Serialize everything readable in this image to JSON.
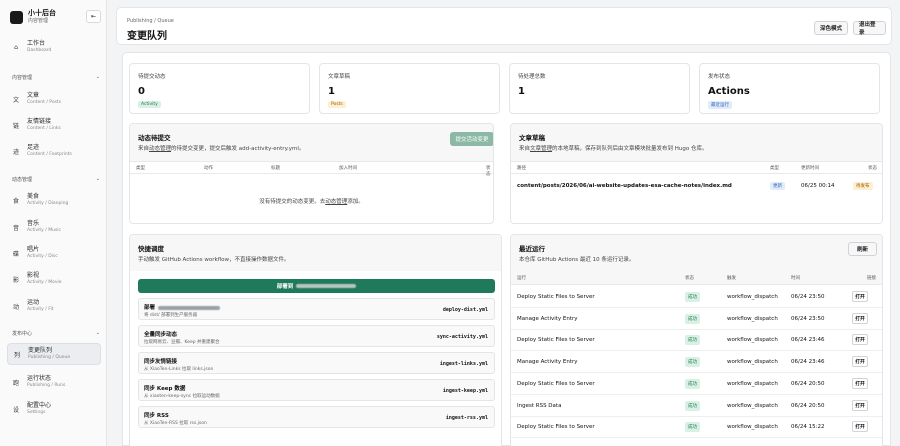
{
  "brand": {
    "name": "小十后台",
    "subtitle": "内容管理"
  },
  "sidebar": {
    "dashboard": {
      "icon": "⌂",
      "label": "工作台",
      "sub": "Dashboard"
    },
    "sections": [
      {
        "label": "内容管理",
        "items": [
          {
            "icon": "文",
            "label": "文章",
            "sub": "Content / Posts"
          },
          {
            "icon": "链",
            "label": "友情链接",
            "sub": "Content / Links"
          },
          {
            "icon": "迹",
            "label": "足迹",
            "sub": "Content / Footprints"
          }
        ]
      },
      {
        "label": "动态管理",
        "items": [
          {
            "icon": "食",
            "label": "美食",
            "sub": "Activity / Dianping"
          },
          {
            "icon": "音",
            "label": "音乐",
            "sub": "Activity / Music"
          },
          {
            "icon": "碟",
            "label": "唱片",
            "sub": "Activity / Disc"
          },
          {
            "icon": "影",
            "label": "影视",
            "sub": "Activity / Movie"
          },
          {
            "icon": "动",
            "label": "运动",
            "sub": "Activity / Fit"
          }
        ]
      },
      {
        "label": "发布中心",
        "items": [
          {
            "icon": "列",
            "label": "变更队列",
            "sub": "Publishing / Queue"
          },
          {
            "icon": "跑",
            "label": "运行状态",
            "sub": "Publishing / Runs"
          },
          {
            "icon": "设",
            "label": "配置中心",
            "sub": "Settings"
          }
        ]
      }
    ]
  },
  "header": {
    "breadcrumb": "Publishing / Queue",
    "title": "变更队列",
    "dark_mode": "深色模式",
    "logout": "退出登录"
  },
  "stats": [
    {
      "title": "待提交动态",
      "value": "0",
      "badge": "Activity"
    },
    {
      "title": "文章草稿",
      "value": "1",
      "badge": "Posts"
    },
    {
      "title": "待处理总数",
      "value": "1",
      "badge": ""
    },
    {
      "title": "发布状态",
      "value": "Actions",
      "badge": "最近运行"
    }
  ],
  "activity_panel": {
    "title": "动态待提交",
    "desc_pre": "来自",
    "desc_link": "动态管理",
    "desc_post": "的待提交变更，提交后触发 add-activity-entry.yml。",
    "submit_button": "提交活动变更",
    "columns": [
      "类型",
      "动作",
      "标题",
      "加入时间",
      "状态"
    ],
    "empty_pre": "没有待提交的动态变更。去",
    "empty_link": "动态管理",
    "empty_post": "添加。"
  },
  "draft_panel": {
    "title": "文章草稿",
    "desc_pre": "来自",
    "desc_link": "文章管理",
    "desc_post": "的本地草稿，保存到队列后由文章模块批量发布到 Hugo 仓库。",
    "columns": [
      "路径",
      "类型",
      "更新时间",
      "状态"
    ],
    "rows": [
      {
        "path": "content/posts/2026/06/ai-website-updates-esa-cache-notes/index.md",
        "type": "更新",
        "time": "06/25 00:14",
        "status": "待发布"
      }
    ]
  },
  "quick_panel": {
    "title": "快捷调度",
    "desc": "手动触发 GitHub Actions workflow，不直接操作数据文件。",
    "deploy_label": "部署到",
    "items": [
      {
        "title": "部署",
        "sub": "将 dist/ 部署到生产服务器",
        "code": "deploy-dist.yml"
      },
      {
        "title": "全量同步动态",
        "sub": "拉取网易云、豆瓣、Keep 并重建聚合",
        "code": "sync-activity.yml"
      },
      {
        "title": "同步友情链接",
        "sub": "从 XiaoTen-Links 拉取 links.json",
        "code": "ingest-links.yml"
      },
      {
        "title": "同步 Keep 数据",
        "sub": "从 xiaoten-keep-sync 拉取运动数据",
        "code": "ingest-keep.yml"
      },
      {
        "title": "同步 RSS",
        "sub": "从 XiaoTen-RSS 拉取 rss.json",
        "code": "ingest-rss.yml"
      }
    ]
  },
  "runs_panel": {
    "title": "最近运行",
    "desc": "本仓库 GitHub Actions 最近 10 条运行记录。",
    "refresh": "刷新",
    "columns": [
      "运行",
      "状态",
      "触发",
      "时间",
      "链接"
    ],
    "open_label": "打开",
    "rows": [
      {
        "name": "Deploy Static Files to Server",
        "status": "成功",
        "trigger": "workflow_dispatch",
        "time": "06/24 23:50"
      },
      {
        "name": "Manage Activity Entry",
        "status": "成功",
        "trigger": "workflow_dispatch",
        "time": "06/24 23:50"
      },
      {
        "name": "Deploy Static Files to Server",
        "status": "成功",
        "trigger": "workflow_dispatch",
        "time": "06/24 23:46"
      },
      {
        "name": "Manage Activity Entry",
        "status": "成功",
        "trigger": "workflow_dispatch",
        "time": "06/24 23:46"
      },
      {
        "name": "Deploy Static Files to Server",
        "status": "成功",
        "trigger": "workflow_dispatch",
        "time": "06/24 20:50"
      },
      {
        "name": "Ingest RSS Data",
        "status": "成功",
        "trigger": "workflow_dispatch",
        "time": "06/24 20:50"
      },
      {
        "name": "Deploy Static Files to Server",
        "status": "成功",
        "trigger": "workflow_dispatch",
        "time": "06/24 15:22"
      }
    ]
  },
  "colors": {
    "accent": "#1f7a5c",
    "success_bg": "#d9f1e4",
    "success_fg": "#1e7a4c",
    "warn_bg": "#fdf0d2",
    "warn_fg": "#9a5b00",
    "info_bg": "#e1ecfb",
    "info_fg": "#2c5fb3"
  }
}
